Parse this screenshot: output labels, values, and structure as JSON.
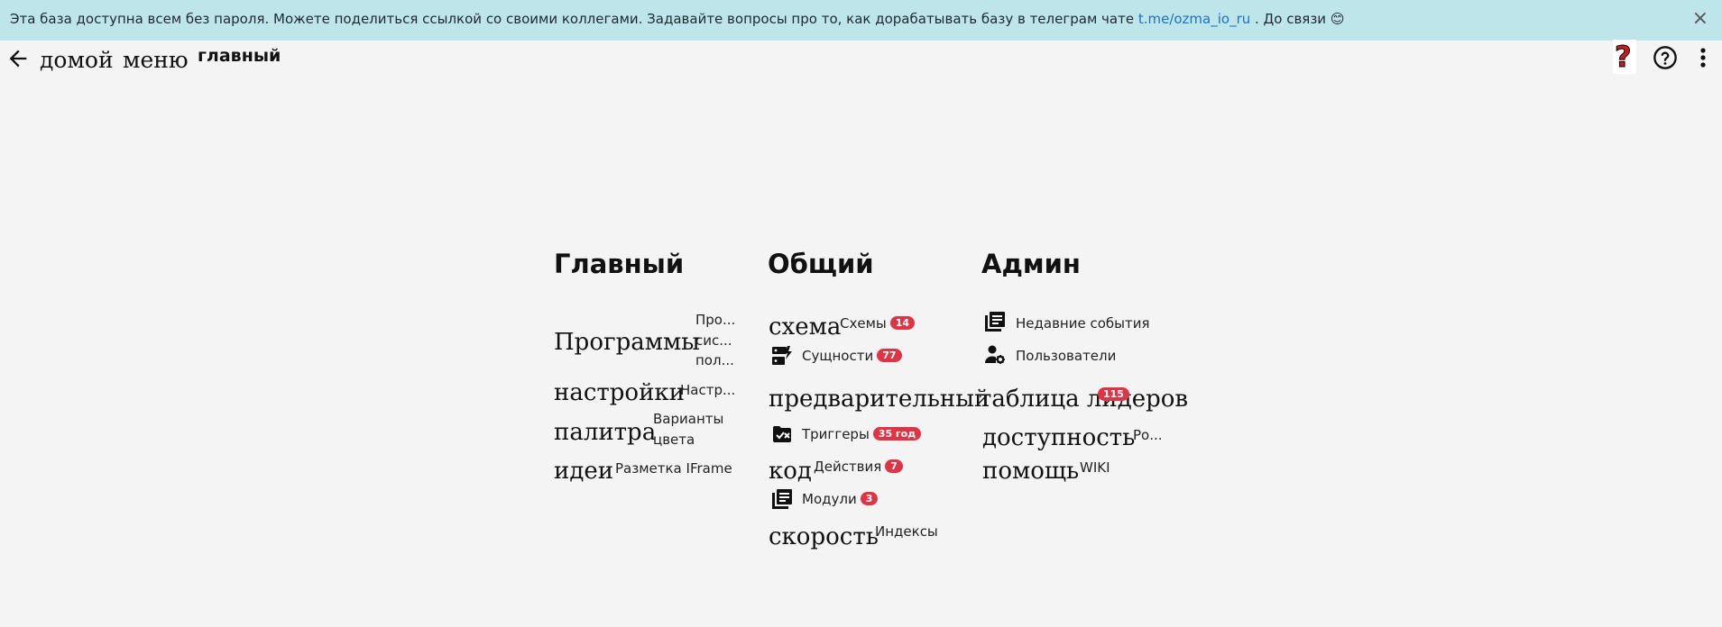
{
  "banner": {
    "text_before": "Эта база доступна всем без пароля. Можете поделиться ссылкой со своими коллегами. Задавайте вопросы про то, как дорабатывать базу в телеграм чате ",
    "link": "t.me/ozma_io_ru",
    "text_after": " . До связи 😊",
    "close": "×"
  },
  "breadcrumbs": {
    "home": "домой",
    "menu": "меню",
    "current": "главный"
  },
  "top_icons": {
    "question_mark": "?",
    "help": "?"
  },
  "columns": {
    "main": {
      "title": "Главный",
      "programs": "Программы",
      "programs_hint": [
        "Про...",
        "сис...",
        "пол..."
      ],
      "settings": "настройки",
      "settings_hint": "Настр...",
      "palette": "палитра",
      "palette_hint": [
        "Варианты",
        "цвета"
      ],
      "ideas": "идеи",
      "ideas_hint": "Разметка IFrame"
    },
    "common": {
      "title": "Общий",
      "schema": "схема",
      "schemas_label": "Схемы",
      "schemas_count": "14",
      "entities_label": "Сущности",
      "entities_count": "77",
      "preliminary": "предварительный",
      "triggers_label": "Триггеры",
      "triggers_count": "35 год",
      "code": "код",
      "actions_label": "Действия",
      "actions_count": "7",
      "modules_label": "Модули",
      "modules_count": "3",
      "speed": "скорость",
      "indexes_label": "Индексы"
    },
    "admin": {
      "title": "Админ",
      "recent_events": "Недавние события",
      "users": "Пользователи",
      "leaders_table": "таблица лидеров",
      "leaders_count": "115",
      "access": "доступность",
      "access_hint": "Ро...",
      "help": "помощь",
      "help_hint": "WIKI"
    }
  }
}
